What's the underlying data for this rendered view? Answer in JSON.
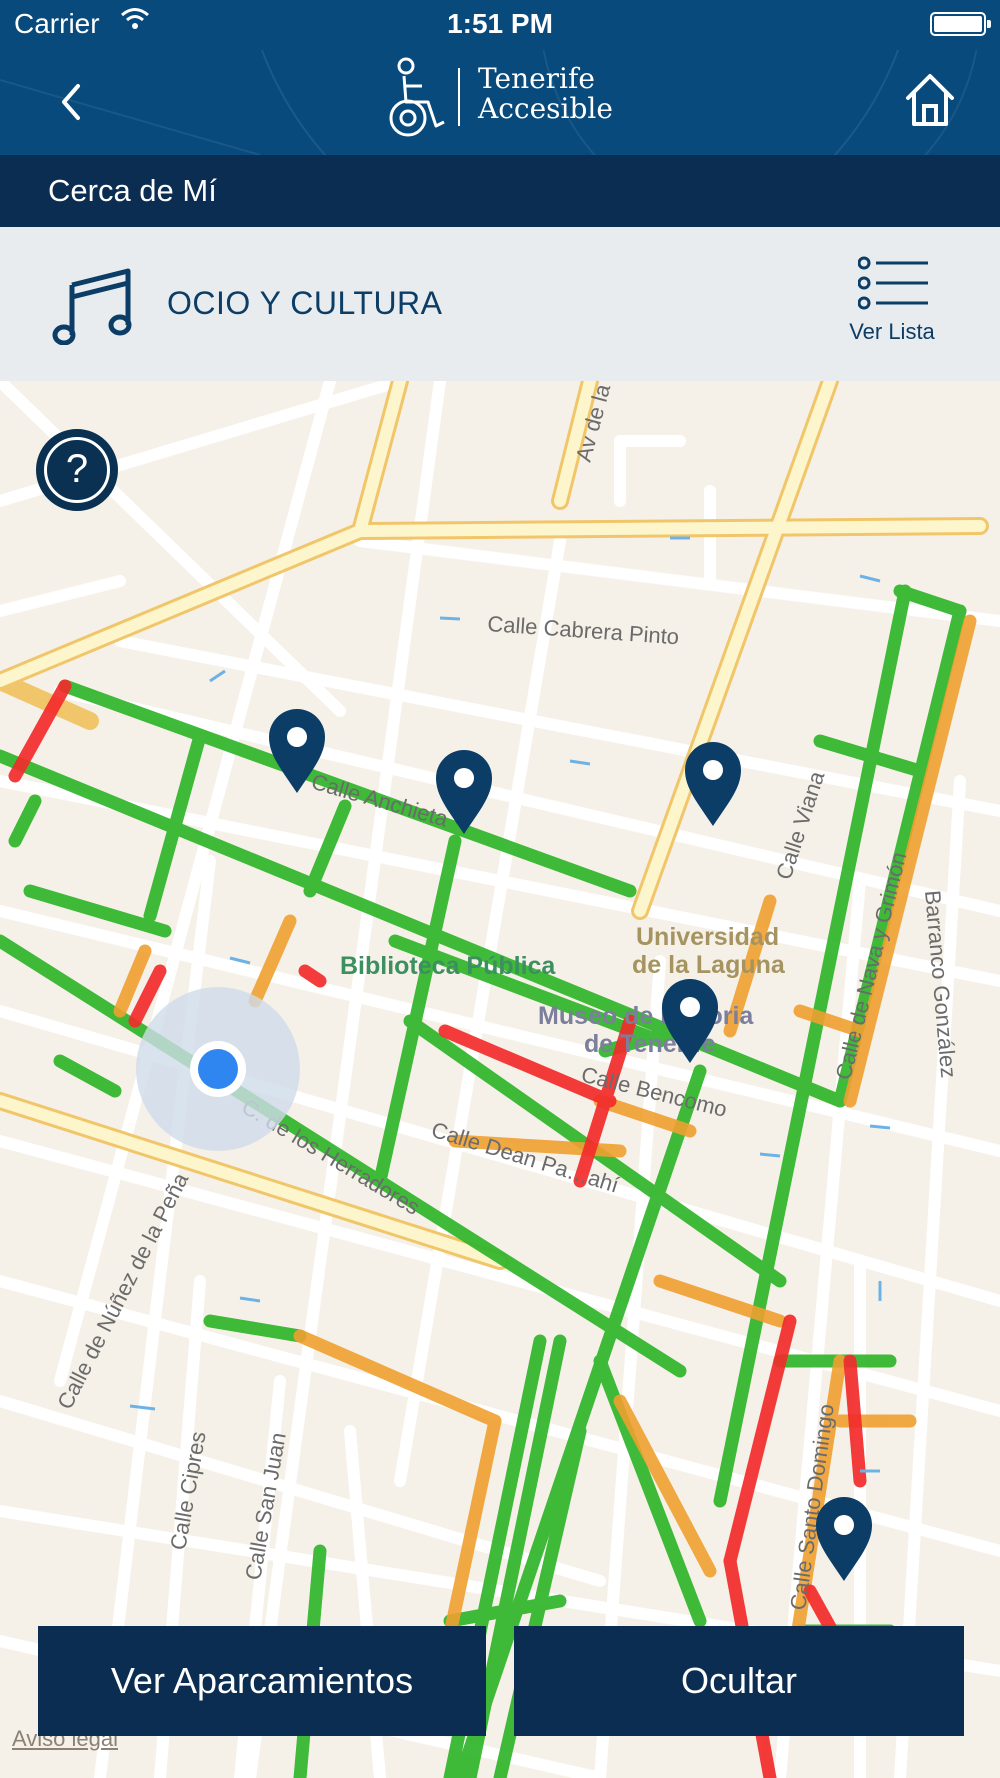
{
  "status_bar": {
    "carrier": "Carrier",
    "time": "1:51 PM"
  },
  "header": {
    "logo_line1": "Tenerife",
    "logo_line2": "Accesible",
    "back_icon": "chevron-left-icon",
    "home_icon": "home-icon"
  },
  "section": {
    "title": "Cerca de Mí"
  },
  "category": {
    "label": "OCIO Y CULTURA",
    "icon": "music-note-icon",
    "list_button": "Ver Lista"
  },
  "map": {
    "help_label": "?",
    "legal": "Aviso legal",
    "labels": {
      "av": "Av de la",
      "cabrera": "Calle Cabrera Pinto",
      "anchieta": "Calle Anchieta",
      "viana": "Calle Viana",
      "obispo": "Calle de Nava y Grimón",
      "barranco": "Barranco González",
      "biblioteca": "Biblioteca Pública",
      "universidad1": "Universidad",
      "universidad2": "de la Laguna",
      "museo1": "Museo de Historia",
      "museo2": "de Tenerife",
      "dean": "Calle Dean Pa…ahí",
      "bencomo": "Calle Bencomo",
      "herradores": "C. de los Herradores",
      "nunez": "Calle de Núñez de la Peña",
      "cipres": "Calle Cipres",
      "sanjuan": "Calle San Juan",
      "santo": "Calle Santo Domingo"
    },
    "accessibility_colors": {
      "accessible": "#2fb52a",
      "partial": "#f0a030",
      "not_accessible": "#f22b2b"
    }
  },
  "buttons": {
    "parking": "Ver Aparcamientos",
    "hide": "Ocultar"
  }
}
